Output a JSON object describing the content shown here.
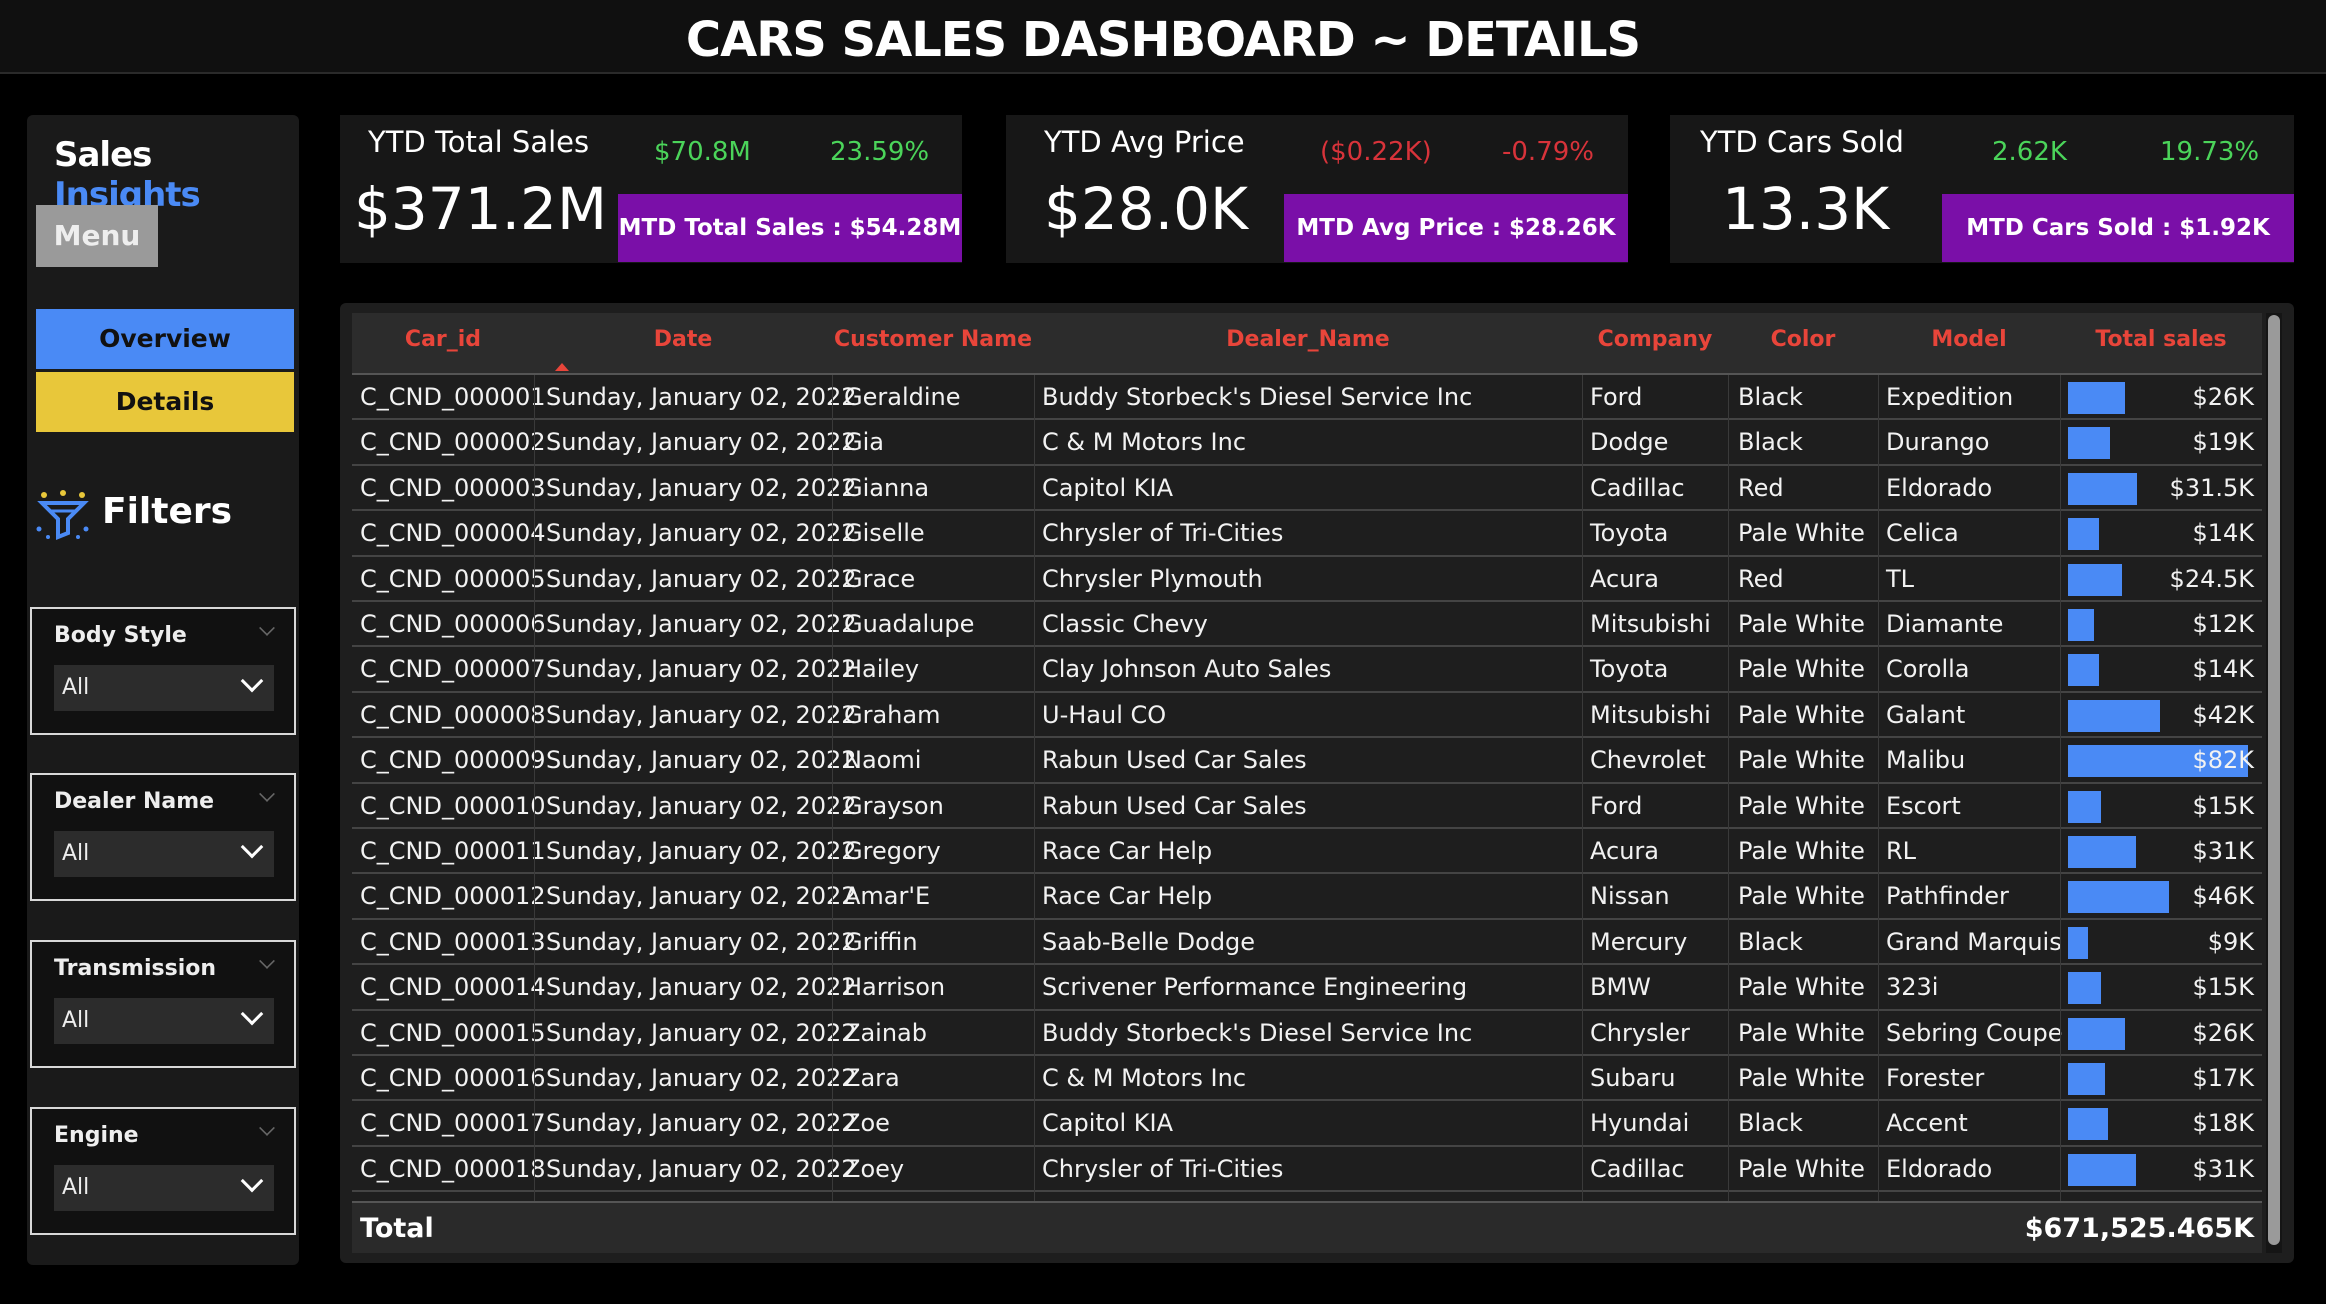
{
  "page": {
    "title": "CARS SALES DASHBOARD ~ DETAILS"
  },
  "sidebar": {
    "brand_part1": "Sales",
    "brand_part2": "Insights",
    "menu_label": "Menu",
    "nav": [
      {
        "label": "Overview",
        "color": "#4a8af5"
      },
      {
        "label": "Details",
        "color": "#e8c73a"
      }
    ],
    "filters_label": "Filters",
    "filters_icon": "funnel-sparkle-icon",
    "slicers": [
      {
        "title": "Body Style",
        "value": "All"
      },
      {
        "title": "Dealer Name",
        "value": "All"
      },
      {
        "title": "Transmission",
        "value": "All"
      },
      {
        "title": "Engine",
        "value": "All"
      }
    ]
  },
  "kpis": [
    {
      "title": "YTD Total Sales",
      "value": "$371.2M",
      "delta1": "$70.8M",
      "delta2": "23.59%",
      "trend": "positive",
      "mtd": "MTD Total Sales : $54.28M"
    },
    {
      "title": "YTD Avg Price",
      "value": "$28.0K",
      "delta1": "($0.22K)",
      "delta2": "-0.79%",
      "trend": "negative",
      "mtd": "MTD Avg Price : $28.26K"
    },
    {
      "title": "YTD Cars Sold",
      "value": "13.3K",
      "delta1": "2.62K",
      "delta2": "19.73%",
      "trend": "positive",
      "mtd": "MTD Cars Sold : $1.92K"
    }
  ],
  "colors": {
    "accent_blue": "#4a8af5",
    "accent_yellow": "#e8c73a",
    "mtd_purple": "#7a0fa8",
    "positive": "#4bd45a",
    "negative": "#d8333a",
    "header_text": "#e8453a"
  },
  "table": {
    "columns": [
      "Car_id",
      "Date",
      "Customer Name",
      "Dealer_Name",
      "Company",
      "Color",
      "Model",
      "Total sales"
    ],
    "sorted_column": "Car_id",
    "sort_direction": "ascending",
    "bar_max": 82,
    "rows": [
      {
        "car_id": "C_CND_000001",
        "date": "Sunday, January 02, 2022",
        "customer": "Geraldine",
        "dealer": "Buddy Storbeck's Diesel Service Inc",
        "company": "Ford",
        "color": "Black",
        "model": "Expedition",
        "sales": "$26K",
        "sales_k": 26
      },
      {
        "car_id": "C_CND_000002",
        "date": "Sunday, January 02, 2022",
        "customer": "Gia",
        "dealer": "C & M Motors Inc",
        "company": "Dodge",
        "color": "Black",
        "model": "Durango",
        "sales": "$19K",
        "sales_k": 19
      },
      {
        "car_id": "C_CND_000003",
        "date": "Sunday, January 02, 2022",
        "customer": "Gianna",
        "dealer": "Capitol KIA",
        "company": "Cadillac",
        "color": "Red",
        "model": "Eldorado",
        "sales": "$31.5K",
        "sales_k": 31.5
      },
      {
        "car_id": "C_CND_000004",
        "date": "Sunday, January 02, 2022",
        "customer": "Giselle",
        "dealer": "Chrysler of Tri-Cities",
        "company": "Toyota",
        "color": "Pale White",
        "model": "Celica",
        "sales": "$14K",
        "sales_k": 14
      },
      {
        "car_id": "C_CND_000005",
        "date": "Sunday, January 02, 2022",
        "customer": "Grace",
        "dealer": "Chrysler Plymouth",
        "company": "Acura",
        "color": "Red",
        "model": "TL",
        "sales": "$24.5K",
        "sales_k": 24.5
      },
      {
        "car_id": "C_CND_000006",
        "date": "Sunday, January 02, 2022",
        "customer": "Guadalupe",
        "dealer": "Classic Chevy",
        "company": "Mitsubishi",
        "color": "Pale White",
        "model": "Diamante",
        "sales": "$12K",
        "sales_k": 12
      },
      {
        "car_id": "C_CND_000007",
        "date": "Sunday, January 02, 2022",
        "customer": "Hailey",
        "dealer": "Clay Johnson Auto Sales",
        "company": "Toyota",
        "color": "Pale White",
        "model": "Corolla",
        "sales": "$14K",
        "sales_k": 14
      },
      {
        "car_id": "C_CND_000008",
        "date": "Sunday, January 02, 2022",
        "customer": "Graham",
        "dealer": "U-Haul CO",
        "company": "Mitsubishi",
        "color": "Pale White",
        "model": "Galant",
        "sales": "$42K",
        "sales_k": 42
      },
      {
        "car_id": "C_CND_000009",
        "date": "Sunday, January 02, 2022",
        "customer": "Naomi",
        "dealer": "Rabun Used Car Sales",
        "company": "Chevrolet",
        "color": "Pale White",
        "model": "Malibu",
        "sales": "$82K",
        "sales_k": 82
      },
      {
        "car_id": "C_CND_000010",
        "date": "Sunday, January 02, 2022",
        "customer": "Grayson",
        "dealer": "Rabun Used Car Sales",
        "company": "Ford",
        "color": "Pale White",
        "model": "Escort",
        "sales": "$15K",
        "sales_k": 15
      },
      {
        "car_id": "C_CND_000011",
        "date": "Sunday, January 02, 2022",
        "customer": "Gregory",
        "dealer": "Race Car Help",
        "company": "Acura",
        "color": "Pale White",
        "model": "RL",
        "sales": "$31K",
        "sales_k": 31
      },
      {
        "car_id": "C_CND_000012",
        "date": "Sunday, January 02, 2022",
        "customer": "Amar'E",
        "dealer": "Race Car Help",
        "company": "Nissan",
        "color": "Pale White",
        "model": "Pathfinder",
        "sales": "$46K",
        "sales_k": 46
      },
      {
        "car_id": "C_CND_000013",
        "date": "Sunday, January 02, 2022",
        "customer": "Griffin",
        "dealer": "Saab-Belle Dodge",
        "company": "Mercury",
        "color": "Black",
        "model": "Grand Marquis",
        "sales": "$9K",
        "sales_k": 9
      },
      {
        "car_id": "C_CND_000014",
        "date": "Sunday, January 02, 2022",
        "customer": "Harrison",
        "dealer": "Scrivener Performance Engineering",
        "company": "BMW",
        "color": "Pale White",
        "model": "323i",
        "sales": "$15K",
        "sales_k": 15
      },
      {
        "car_id": "C_CND_000015",
        "date": "Sunday, January 02, 2022",
        "customer": "Zainab",
        "dealer": "Buddy Storbeck's Diesel Service Inc",
        "company": "Chrysler",
        "color": "Pale White",
        "model": "Sebring Coupe",
        "sales": "$26K",
        "sales_k": 26
      },
      {
        "car_id": "C_CND_000016",
        "date": "Sunday, January 02, 2022",
        "customer": "Zara",
        "dealer": "C & M Motors Inc",
        "company": "Subaru",
        "color": "Pale White",
        "model": "Forester",
        "sales": "$17K",
        "sales_k": 17
      },
      {
        "car_id": "C_CND_000017",
        "date": "Sunday, January 02, 2022",
        "customer": "Zoe",
        "dealer": "Capitol KIA",
        "company": "Hyundai",
        "color": "Black",
        "model": "Accent",
        "sales": "$18K",
        "sales_k": 18
      },
      {
        "car_id": "C_CND_000018",
        "date": "Sunday, January 02, 2022",
        "customer": "Zoey",
        "dealer": "Chrysler of Tri-Cities",
        "company": "Cadillac",
        "color": "Pale White",
        "model": "Eldorado",
        "sales": "$31K",
        "sales_k": 31
      }
    ],
    "total_label": "Total",
    "total_value": "$671,525.465K"
  }
}
